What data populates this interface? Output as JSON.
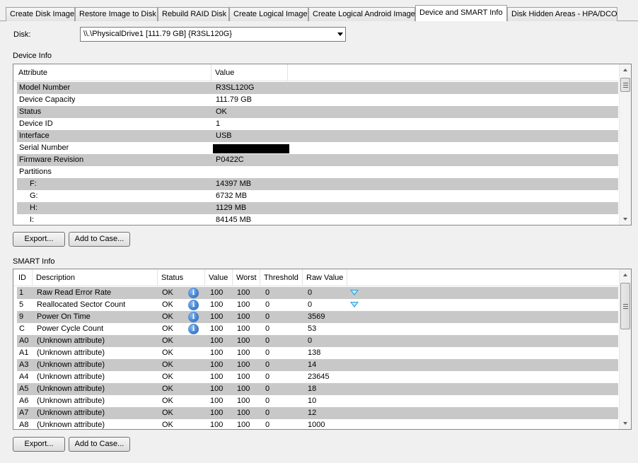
{
  "tabs": [
    {
      "label": "Create Disk Image",
      "active": false
    },
    {
      "label": "Restore Image to Disk",
      "active": false
    },
    {
      "label": "Rebuild RAID Disk",
      "active": false
    },
    {
      "label": "Create Logical Image",
      "active": false
    },
    {
      "label": "Create Logical Android Image",
      "active": false
    },
    {
      "label": "Device and SMART Info",
      "active": true
    },
    {
      "label": "Disk Hidden Areas - HPA/DCO",
      "active": false
    }
  ],
  "disk": {
    "label": "Disk:",
    "selected": "\\\\.\\PhysicalDrive1 [111.79 GB] {R3SL120G}"
  },
  "device_info": {
    "title": "Device Info",
    "columns": [
      "Attribute",
      "Value"
    ],
    "rows": [
      {
        "attr": "Model Number",
        "value": "R3SL120G"
      },
      {
        "attr": "Device Capacity",
        "value": "111.79 GB"
      },
      {
        "attr": "Status",
        "value": "OK"
      },
      {
        "attr": "Device ID",
        "value": "1"
      },
      {
        "attr": "Interface",
        "value": "USB"
      },
      {
        "attr": "Serial Number",
        "value": "",
        "redacted": true
      },
      {
        "attr": "Firmware Revision",
        "value": "P0422C"
      },
      {
        "attr": "Partitions",
        "value": ""
      },
      {
        "attr": "F:",
        "value": "14397 MB",
        "indent": true
      },
      {
        "attr": "G:",
        "value": "6732 MB",
        "indent": true
      },
      {
        "attr": "H:",
        "value": "1129 MB",
        "indent": true
      },
      {
        "attr": "I:",
        "value": "84145 MB",
        "indent": true
      }
    ],
    "export_label": "Export...",
    "add_case_label": "Add to Case..."
  },
  "smart_info": {
    "title": "SMART Info",
    "columns": [
      "ID",
      "Description",
      "Status",
      "Value",
      "Worst",
      "Threshold",
      "Raw Value"
    ],
    "rows": [
      {
        "id": "1",
        "desc": "Raw Read Error Rate",
        "status": "OK",
        "info": true,
        "value": "100",
        "worst": "100",
        "threshold": "0",
        "raw": "0",
        "trend": true
      },
      {
        "id": "5",
        "desc": "Reallocated Sector Count",
        "status": "OK",
        "info": true,
        "value": "100",
        "worst": "100",
        "threshold": "0",
        "raw": "0",
        "trend": true
      },
      {
        "id": "9",
        "desc": "Power On Time",
        "status": "OK",
        "info": true,
        "value": "100",
        "worst": "100",
        "threshold": "0",
        "raw": "3569",
        "trend": false
      },
      {
        "id": "C",
        "desc": "Power Cycle Count",
        "status": "OK",
        "info": true,
        "value": "100",
        "worst": "100",
        "threshold": "0",
        "raw": "53",
        "trend": false
      },
      {
        "id": "A0",
        "desc": "(Unknown attribute)",
        "status": "OK",
        "info": false,
        "value": "100",
        "worst": "100",
        "threshold": "0",
        "raw": "0",
        "trend": false
      },
      {
        "id": "A1",
        "desc": "(Unknown attribute)",
        "status": "OK",
        "info": false,
        "value": "100",
        "worst": "100",
        "threshold": "0",
        "raw": "138",
        "trend": false
      },
      {
        "id": "A3",
        "desc": "(Unknown attribute)",
        "status": "OK",
        "info": false,
        "value": "100",
        "worst": "100",
        "threshold": "0",
        "raw": "14",
        "trend": false
      },
      {
        "id": "A4",
        "desc": "(Unknown attribute)",
        "status": "OK",
        "info": false,
        "value": "100",
        "worst": "100",
        "threshold": "0",
        "raw": "23645",
        "trend": false
      },
      {
        "id": "A5",
        "desc": "(Unknown attribute)",
        "status": "OK",
        "info": false,
        "value": "100",
        "worst": "100",
        "threshold": "0",
        "raw": "18",
        "trend": false
      },
      {
        "id": "A6",
        "desc": "(Unknown attribute)",
        "status": "OK",
        "info": false,
        "value": "100",
        "worst": "100",
        "threshold": "0",
        "raw": "10",
        "trend": false
      },
      {
        "id": "A7",
        "desc": "(Unknown attribute)",
        "status": "OK",
        "info": false,
        "value": "100",
        "worst": "100",
        "threshold": "0",
        "raw": "12",
        "trend": false
      },
      {
        "id": "A8",
        "desc": "(Unknown attribute)",
        "status": "OK",
        "info": false,
        "value": "100",
        "worst": "100",
        "threshold": "0",
        "raw": "1000",
        "trend": false
      }
    ],
    "export_label": "Export...",
    "add_case_label": "Add to Case..."
  },
  "icons": {
    "info": "info-icon",
    "trend": "trend-down-icon"
  },
  "colors": {
    "row_alt": "#c8c8c8",
    "info_icon": "#1a5fb4",
    "trend_icon": "#2aa0d8"
  }
}
